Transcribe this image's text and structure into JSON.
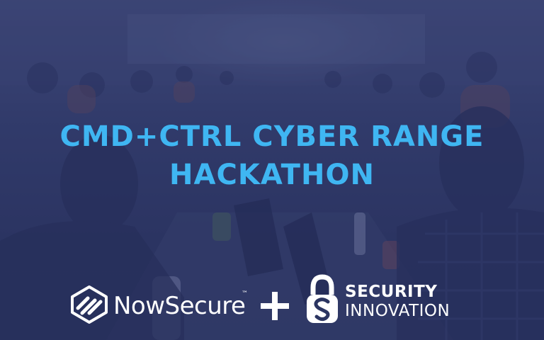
{
  "banner": {
    "title_line1": "CMD+CTRL CYBER RANGE",
    "title_line2": "HACKATHON",
    "title_color": "#3fb6f2",
    "background_color": "#2b3561"
  },
  "logos": {
    "nowsecure": {
      "icon": "nowsecure-logo-icon",
      "name": "NowSecure",
      "trademark": "™"
    },
    "plus": "plus-icon",
    "security_innovation": {
      "icon": "padlock-s-logo-icon",
      "line1": "SECURITY",
      "line2": "INNOVATION"
    }
  }
}
